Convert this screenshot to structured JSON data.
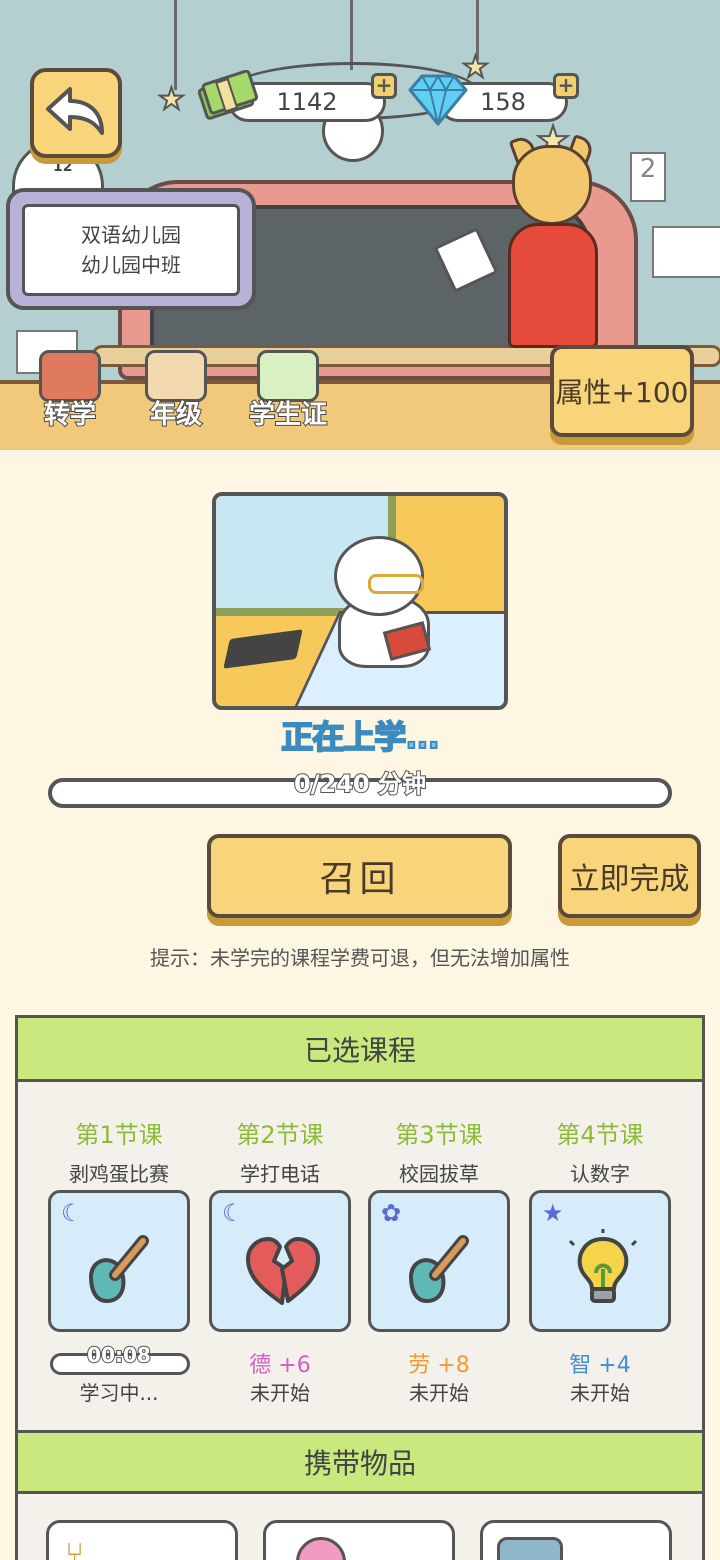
{
  "header": {
    "cash_value": "1142",
    "gem_value": "158",
    "age_label": "12",
    "school_name": "双语幼儿园",
    "class_name": "幼儿园中班",
    "note_label": "2"
  },
  "quick_actions": [
    {
      "label": "转学",
      "icon": "school-building-icon"
    },
    {
      "label": "年级",
      "icon": "grade-books-icon"
    },
    {
      "label": "学生证",
      "icon": "student-card-icon"
    }
  ],
  "attribute_button": "属性+100",
  "activity": {
    "status": "正在上学...",
    "progress_text": "0/240 分钟",
    "progress": 0,
    "recall_label": "召回",
    "finish_label": "立即完成",
    "hint": "提示：未学完的课程学费可退，但无法增加属性"
  },
  "courses_panel": {
    "title": "已选课程",
    "courses": [
      {
        "number": "第1节课",
        "name": "剥鸡蛋比赛",
        "badge": "moon-icon",
        "icon": "shovel-icon",
        "timer": "00:08",
        "state": "学习中..."
      },
      {
        "number": "第2节课",
        "name": "学打电话",
        "badge": "moon-icon",
        "icon": "broken-heart-icon",
        "reward": "德 +6",
        "reward_color": "#d45fc4",
        "state": "未开始"
      },
      {
        "number": "第3节课",
        "name": "校园拔草",
        "badge": "gear-icon",
        "icon": "shovel-icon",
        "reward": "劳 +8",
        "reward_color": "#ee9a3c",
        "state": "未开始"
      },
      {
        "number": "第4节课",
        "name": "认数字",
        "badge": "star-icon",
        "icon": "lightbulb-icon",
        "reward": "智 +4",
        "reward_color": "#3e8fd6",
        "state": "未开始"
      }
    ]
  },
  "items_panel": {
    "title": "携带物品"
  },
  "colors": {
    "accent_yellow": "#f8d57a",
    "panel_green": "#c9e87d",
    "status_blue": "#7fc4ea",
    "background": "#fdf6e3"
  }
}
